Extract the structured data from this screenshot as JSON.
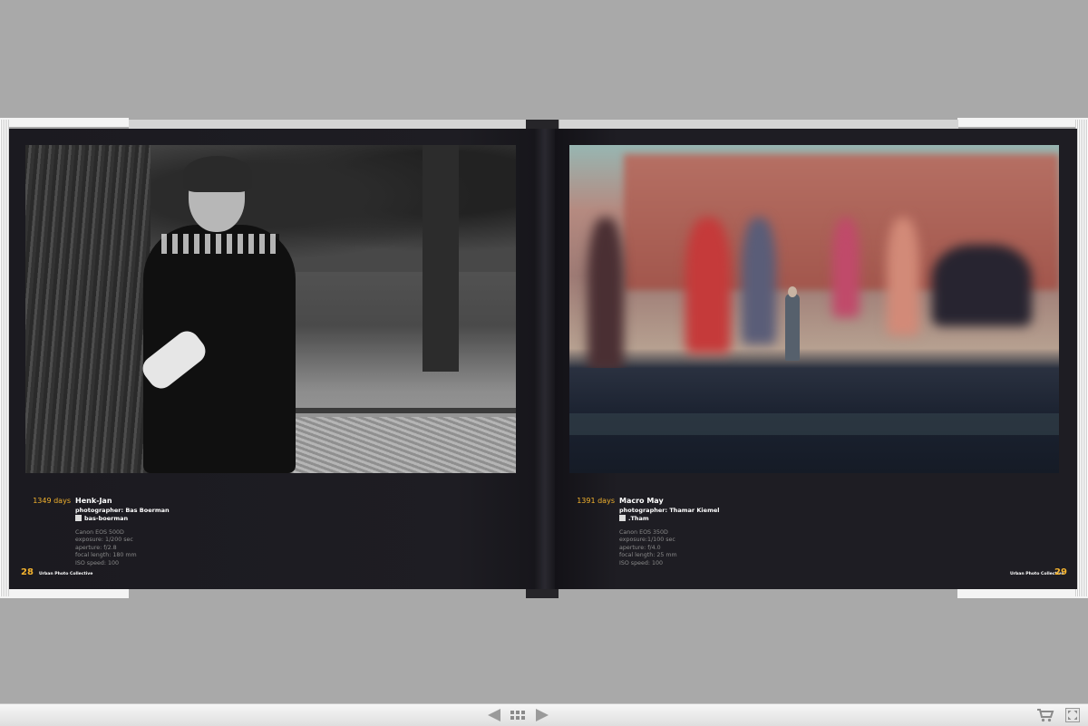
{
  "spread": {
    "left_page": {
      "days": "1349 days",
      "title": "Henk-Jan",
      "photographer": "photographer: Bas Boerman",
      "handle": "bas-boerman",
      "specs": [
        "Canon EOS 500D",
        "exposure: 1/200 sec",
        "aperture: f/2.8",
        "focal length: 180 mm",
        "ISO speed: 100"
      ],
      "page_number": "28",
      "footer": "Urban Photo Collective"
    },
    "right_page": {
      "days": "1391 days",
      "title": "Macro May",
      "photographer": "photographer: Thamar Kiemel",
      "handle": ".Tham",
      "specs": [
        "Canon EOS 350D",
        "exposure:1/100 sec",
        "aperture: f/4.0",
        "focal length: 25 mm",
        "ISO speed: 100"
      ],
      "page_number": "29",
      "footer": "Urban Photo Collective"
    }
  },
  "toolbar": {
    "prev_icon": "arrow-left-icon",
    "grid_icon": "grid-icon",
    "next_icon": "arrow-right-icon",
    "cart_icon": "cart-icon",
    "fullscreen_icon": "fullscreen-icon"
  },
  "colors": {
    "background": "#a9a9a9",
    "page": "#1d1c22",
    "accent": "#f2b22e"
  }
}
